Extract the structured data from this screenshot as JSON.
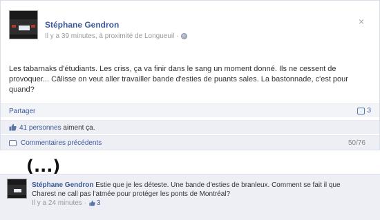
{
  "post": {
    "author": "Stéphane Gendron",
    "meta": "Il y a 39 minutes, à proximité de Longueuil ·",
    "close_glyph": "×",
    "body": "Les tabarnaks d'étudiants. Les criss, ça va finir dans le sang un moment donné. Ils ne cessent de provoquer... Câlisse on veut aller travailler bande d'esties de puants sales. La bastonnade, c'est pour quand?",
    "share_label": "Partager",
    "share_count": "3",
    "likes_link": "41 personnes",
    "likes_rest": " aiment ça.",
    "comments_label": "Commentaires précédents",
    "comments_count": "50/76"
  },
  "separator": "(...)",
  "comment": {
    "author": "Stéphane Gendron",
    "text": " Estie que je les déteste. Une bande d'esties de branleux. Comment se fait il que Charest ne call pas l'atmée pour protéger les ponts de Montréal?",
    "time": "Il y a 24 minutes ·",
    "like_count": "3"
  },
  "colors": {
    "link": "#3b5998",
    "meta": "#999999",
    "bar_bg": "#edeff4",
    "border": "#d8dfea"
  },
  "icons": [
    "globe-icon",
    "close-icon",
    "share-icon",
    "thumb-up-icon",
    "comment-bubble-icon"
  ]
}
